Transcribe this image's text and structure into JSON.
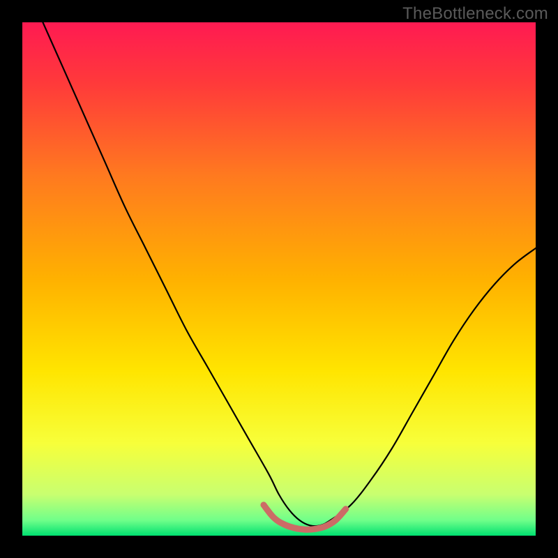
{
  "watermark": "TheBottleneck.com",
  "chart_data": {
    "type": "line",
    "title": "",
    "xlabel": "",
    "ylabel": "",
    "xlim": [
      0,
      100
    ],
    "ylim": [
      0,
      100
    ],
    "grid": false,
    "legend": false,
    "background_gradient": {
      "stops": [
        {
          "offset": 0,
          "color": "#ff1a52"
        },
        {
          "offset": 0.12,
          "color": "#ff3a3a"
        },
        {
          "offset": 0.3,
          "color": "#ff7a1f"
        },
        {
          "offset": 0.5,
          "color": "#ffb100"
        },
        {
          "offset": 0.68,
          "color": "#ffe500"
        },
        {
          "offset": 0.82,
          "color": "#f7ff3a"
        },
        {
          "offset": 0.92,
          "color": "#c8ff70"
        },
        {
          "offset": 0.97,
          "color": "#70ff8a"
        },
        {
          "offset": 1.0,
          "color": "#00e070"
        }
      ]
    },
    "series": [
      {
        "name": "bottleneck-curve",
        "color": "#000000",
        "width": 2.2,
        "x": [
          4,
          8,
          12,
          16,
          20,
          24,
          28,
          32,
          36,
          40,
          44,
          48,
          50,
          52,
          54,
          56,
          58,
          60,
          64,
          68,
          72,
          76,
          80,
          84,
          88,
          92,
          96,
          100
        ],
        "y": [
          100,
          91,
          82,
          73,
          64,
          56,
          48,
          40,
          33,
          26,
          19,
          12,
          8,
          5,
          3,
          2,
          2,
          3,
          6,
          11,
          17,
          24,
          31,
          38,
          44,
          49,
          53,
          56
        ]
      },
      {
        "name": "optimum-band",
        "color": "#cc6b66",
        "width": 9,
        "linecap": "round",
        "x": [
          47,
          49,
          51,
          53,
          55,
          57,
          59,
          61,
          63
        ],
        "y": [
          6.0,
          3.5,
          2.2,
          1.5,
          1.2,
          1.3,
          1.8,
          3.0,
          5.2
        ]
      }
    ]
  }
}
